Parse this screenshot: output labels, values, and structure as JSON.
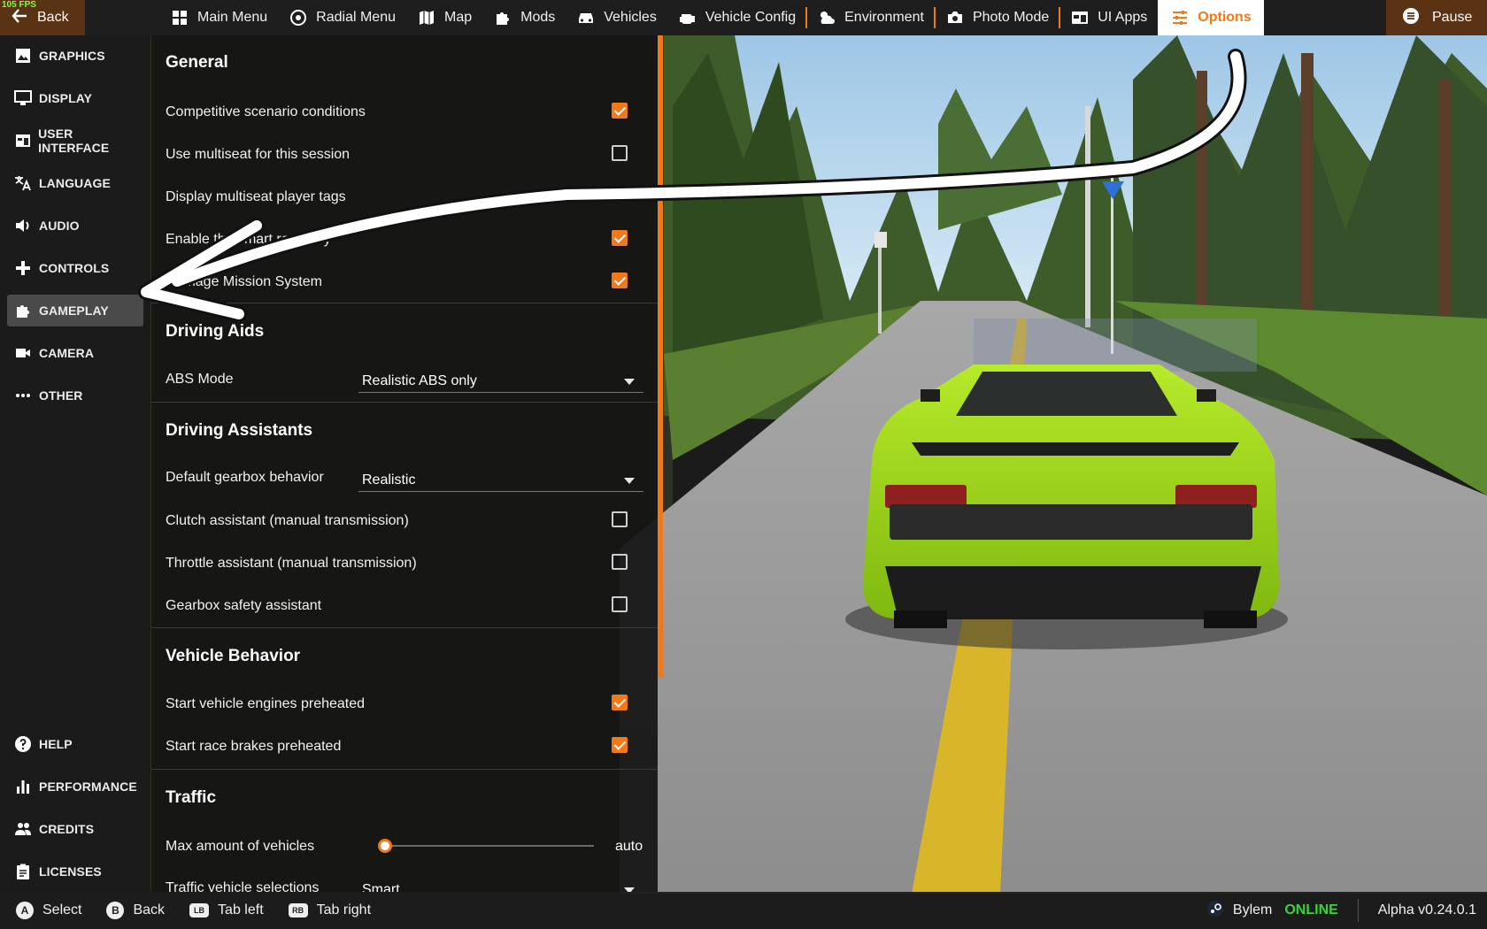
{
  "topbar": {
    "fps": "105 FPS",
    "back_label": "Back",
    "pause_label": "Pause",
    "items": [
      {
        "label": "Main Menu",
        "icon": "main-menu-icon"
      },
      {
        "label": "Radial Menu",
        "icon": "radial-menu-icon"
      },
      {
        "label": "Map",
        "icon": "map-icon"
      },
      {
        "label": "Mods",
        "icon": "puzzle-icon"
      },
      {
        "label": "Vehicles",
        "icon": "car-icon"
      },
      {
        "label": "Vehicle Config",
        "icon": "engine-icon"
      },
      {
        "label": "Environment",
        "icon": "weather-icon"
      },
      {
        "label": "Photo Mode",
        "icon": "camera-icon"
      },
      {
        "label": "UI Apps",
        "icon": "ui-apps-icon"
      },
      {
        "label": "Options",
        "icon": "sliders-icon",
        "active": true
      }
    ]
  },
  "sidebar": {
    "items": [
      {
        "label": "GRAPHICS",
        "icon": "image-icon"
      },
      {
        "label": "DISPLAY",
        "icon": "monitor-icon"
      },
      {
        "label": "USER INTERFACE",
        "icon": "window-icon"
      },
      {
        "label": "LANGUAGE",
        "icon": "translate-icon"
      },
      {
        "label": "AUDIO",
        "icon": "speaker-icon"
      },
      {
        "label": "CONTROLS",
        "icon": "gamepad-icon"
      },
      {
        "label": "GAMEPLAY",
        "icon": "puzzle-icon",
        "active": true
      },
      {
        "label": "CAMERA",
        "icon": "video-camera-icon"
      },
      {
        "label": "OTHER",
        "icon": "more-icon"
      }
    ],
    "bottom_items": [
      {
        "label": "HELP",
        "icon": "help-icon"
      },
      {
        "label": "PERFORMANCE",
        "icon": "bar-chart-icon"
      },
      {
        "label": "CREDITS",
        "icon": "people-icon"
      },
      {
        "label": "LICENSES",
        "icon": "clipboard-icon"
      }
    ]
  },
  "panel": {
    "general": {
      "title": "General",
      "rows": [
        {
          "label": "Competitive scenario conditions",
          "checked": true
        },
        {
          "label": "Use multiseat for this session",
          "checked": false
        },
        {
          "label": "Display multiseat player tags"
        },
        {
          "label": "Enable the smart recovery",
          "checked": true
        },
        {
          "label": "Damage Mission System",
          "checked": true
        }
      ]
    },
    "driving_aids": {
      "title": "Driving Aids",
      "abs_label": "ABS Mode",
      "abs_value": "Realistic ABS only"
    },
    "driving_assistants": {
      "title": "Driving Assistants",
      "gearbox_label": "Default gearbox behavior",
      "gearbox_value": "Realistic",
      "rows": [
        {
          "label": "Clutch assistant (manual transmission)",
          "checked": false
        },
        {
          "label": "Throttle assistant (manual transmission)",
          "checked": false
        },
        {
          "label": "Gearbox safety assistant",
          "checked": false
        }
      ]
    },
    "vehicle_behavior": {
      "title": "Vehicle Behavior",
      "rows": [
        {
          "label": "Start vehicle engines preheated",
          "checked": true
        },
        {
          "label": "Start race brakes preheated",
          "checked": true
        }
      ]
    },
    "traffic": {
      "title": "Traffic",
      "max_label": "Max amount of vehicles",
      "max_value": "auto",
      "max_fraction": 0.0,
      "selection_label": "Traffic vehicle selections",
      "selection_value": "Smart"
    }
  },
  "bottombar": {
    "hints": [
      {
        "button": "A",
        "label": "Select"
      },
      {
        "button": "B",
        "label": "Back"
      },
      {
        "button": "LB",
        "label": "Tab left"
      },
      {
        "button": "RB",
        "label": "Tab right"
      }
    ],
    "username": "Bylem",
    "status": "ONLINE",
    "version": "Alpha v0.24.0.1"
  },
  "colors": {
    "accent": "#f07a1a",
    "online": "#3cd23c",
    "car": "#9ad11a"
  }
}
